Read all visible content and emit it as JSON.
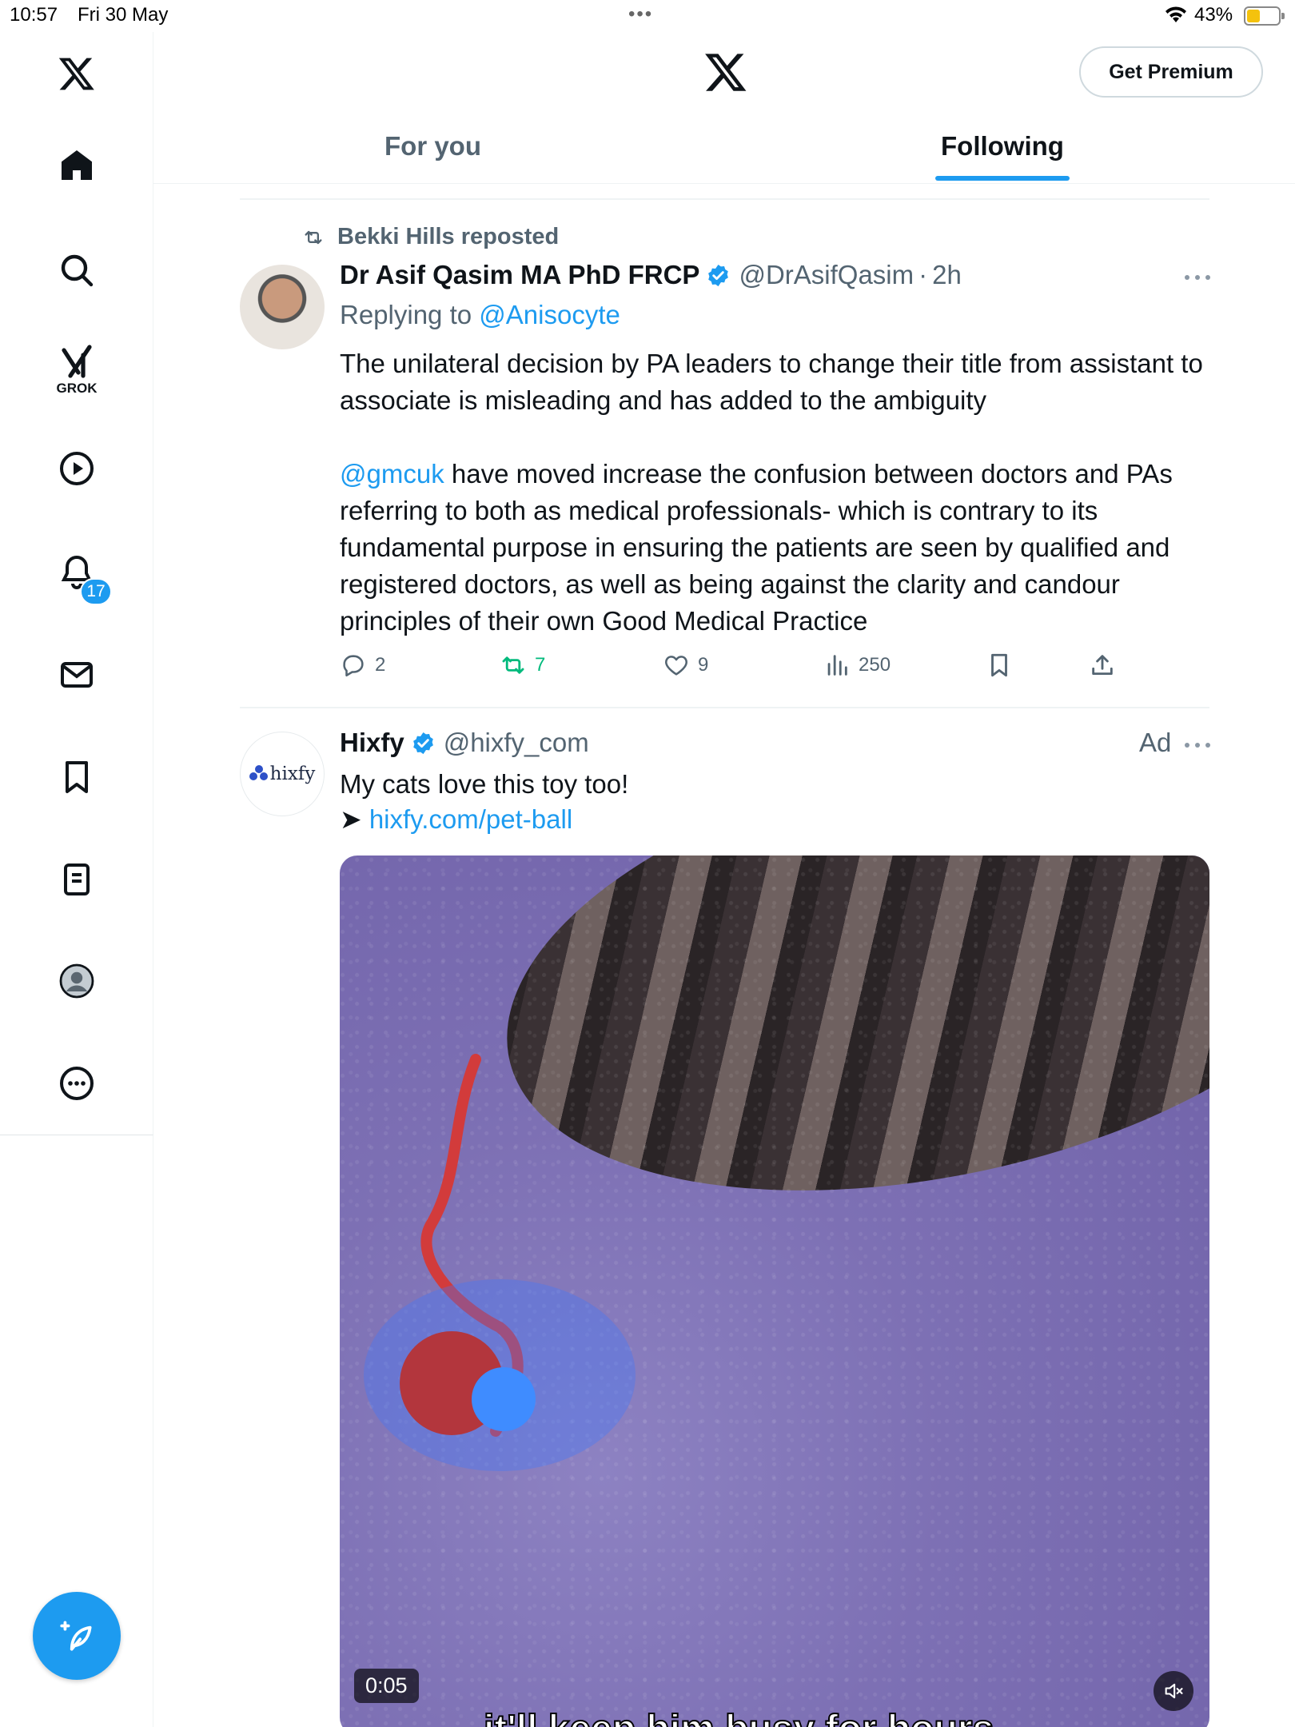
{
  "status_bar": {
    "time": "10:57",
    "date": "Fri 30 May",
    "battery": "43%",
    "battery_level": 0.43
  },
  "sidebar": {
    "items": [
      {
        "icon": "x-logo-icon"
      },
      {
        "icon": "home-icon"
      },
      {
        "icon": "search-icon"
      },
      {
        "icon": "grok-icon",
        "label": "GROK"
      },
      {
        "icon": "video-play-icon"
      },
      {
        "icon": "notifications-bell-icon",
        "badge": "17"
      },
      {
        "icon": "messages-envelope-icon"
      },
      {
        "icon": "bookmarks-icon"
      },
      {
        "icon": "lists-icon"
      },
      {
        "icon": "profile-icon"
      },
      {
        "icon": "more-circle-icon"
      }
    ],
    "compose_icon": "compose-feather-icon"
  },
  "header": {
    "premium_label": "Get Premium"
  },
  "tabs": [
    {
      "label": "For you",
      "active": false
    },
    {
      "label": "Following",
      "active": true
    }
  ],
  "feed": {
    "tweet1": {
      "repost_by": "Bekki Hills reposted",
      "name": "Dr Asif Qasim MA PhD FRCP",
      "handle": "@DrAsifQasim",
      "separator": "·",
      "time": "2h",
      "replying_label": "Replying to",
      "replying_to": "@Anisocyte",
      "text_p1": "The unilateral decision by PA leaders to change their title from assistant to associate is misleading and has added to the ambiguity",
      "text_p2_mention": "@gmcuk",
      "text_p2": " have moved increase the confusion between doctors and PAs referring to both as medical professionals- which is contrary to its fundamental purpose in ensuring the patients are seen by qualified and registered doctors, as well as being against the clarity and candour principles of their own Good Medical Practice",
      "replies": "2",
      "reposts": "7",
      "likes": "9",
      "views": "250"
    },
    "tweet2": {
      "avatar_text": "hixfy",
      "name": "Hixfy",
      "handle": "@hixfy_com",
      "ad_label": "Ad",
      "text": "My cats love this toy too!",
      "link_arrow": "➤ ",
      "link": "hixfy.com/pet-ball",
      "video_time": "0:05",
      "caption": "it'll keep him busy for hours"
    }
  },
  "colors": {
    "accent": "#1d9bf0",
    "retweet_green": "#00ba7c",
    "secondary_text": "#536471"
  }
}
